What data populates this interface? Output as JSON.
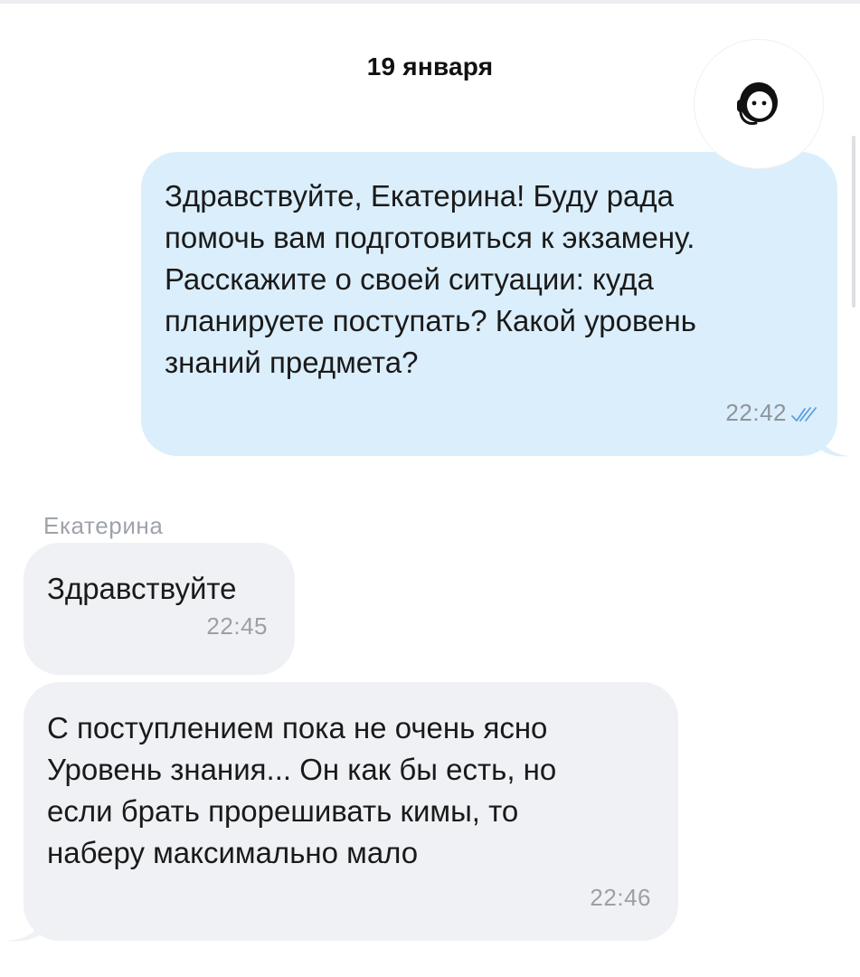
{
  "date_separator": "19 января",
  "messages": [
    {
      "direction": "outgoing",
      "text": "Здравствуйте, Екатерина! Буду рада\nпомочь вам подготовиться к экзамену.\nРасскажите о своей ситуации: куда\nпланируете поступать? Какой уровень\nзнаний предмета?",
      "time": "22:42",
      "status_icon": "double-check-icon"
    },
    {
      "direction": "incoming",
      "sender": "Екатерина",
      "text": "Здравствуйте",
      "time": "22:45"
    },
    {
      "direction": "incoming",
      "text": "С поступлением пока не очень ясно\nУровень знания... Он как бы есть, но\nесли брать прорешивать кимы, то\nнаберу максимально мало",
      "time": "22:46"
    }
  ],
  "avatar": {
    "icon": "support-agent-icon"
  },
  "colors": {
    "outgoing_bubble": "#dbeefb",
    "incoming_bubble": "#f0f1f4",
    "read_check": "#5a9fe0",
    "time_text": "#9aa0a8"
  }
}
